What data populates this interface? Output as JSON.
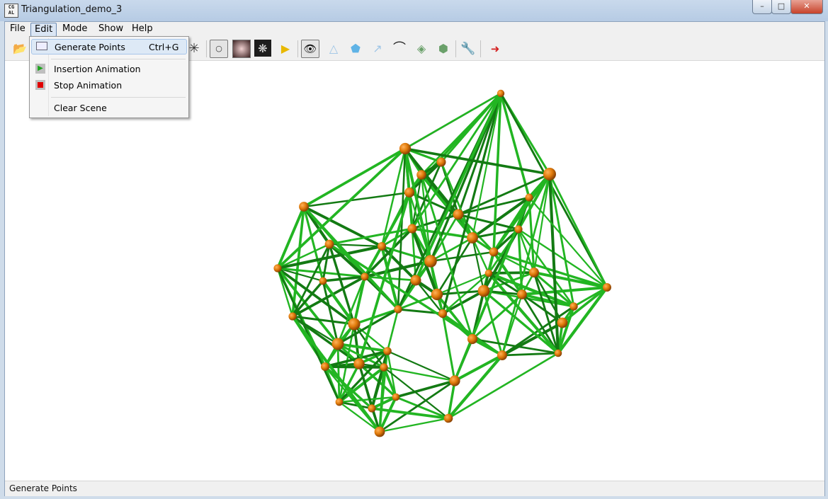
{
  "window": {
    "title": "Triangulation_demo_3",
    "icon_text": "CG AL"
  },
  "controls": {
    "minimize": "–",
    "maximize": "□",
    "close": "✕"
  },
  "menubar": {
    "items": [
      "File",
      "Edit",
      "Mode",
      "Show",
      "Help"
    ]
  },
  "edit_menu": {
    "generate_points": {
      "label": "Generate Points",
      "shortcut": "Ctrl+G"
    },
    "insertion_animation": {
      "label": "Insertion Animation"
    },
    "stop_animation": {
      "label": "Stop Animation"
    },
    "clear_scene": {
      "label": "Clear Scene"
    }
  },
  "toolbar_icons": [
    "folder-open-icon",
    "star-icon",
    "point-mode-icon",
    "blurred-texture-icon",
    "spider-web-icon",
    "play-icon",
    "eye-icon",
    "triangle-icon",
    "pentagon-icon",
    "arrow-icon",
    "arc-icon",
    "polygon-icon",
    "mesh-icon",
    "tools-icon",
    "exit-icon"
  ],
  "status": {
    "text": "Generate Points"
  },
  "colors": {
    "edge": "#22b522",
    "edge_dark": "#137a13",
    "vertex": "#e07a0a",
    "vertex_dark": "#8a4204"
  }
}
